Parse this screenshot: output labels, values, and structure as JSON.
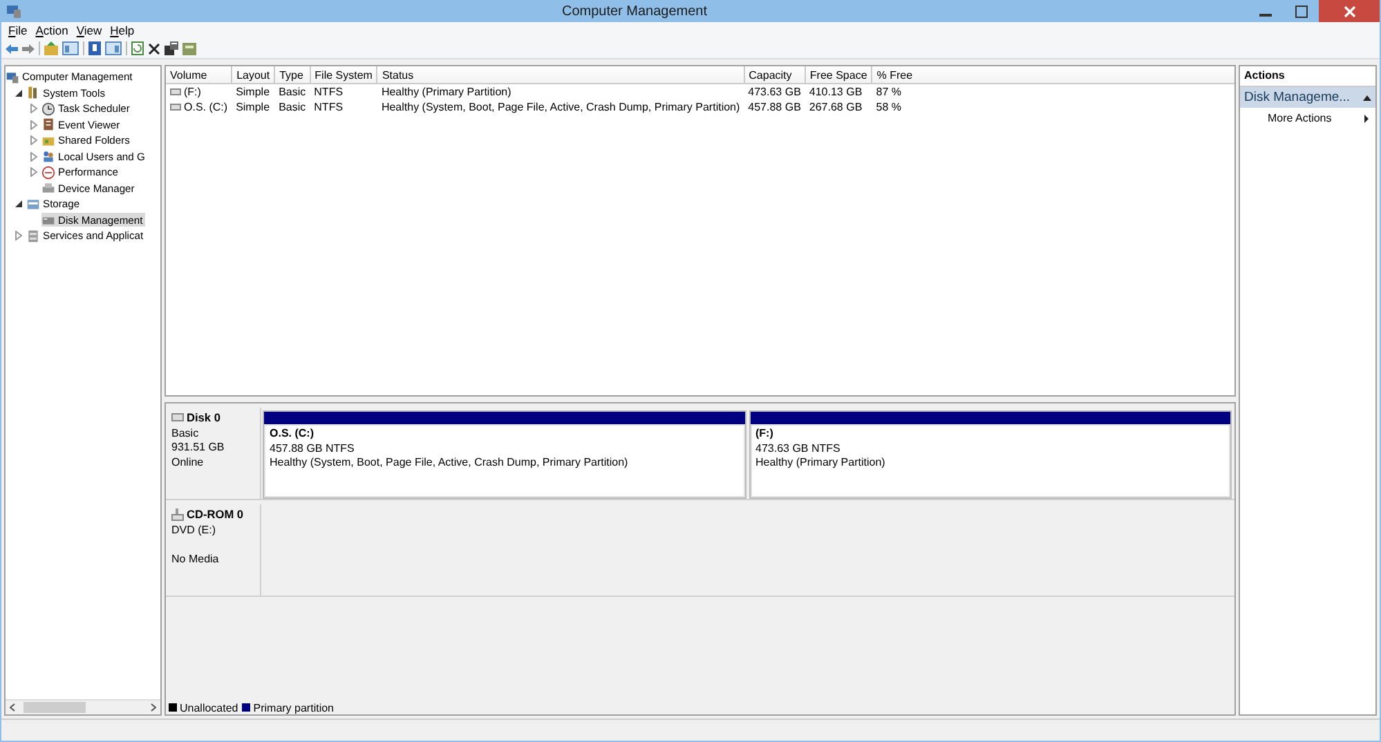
{
  "window": {
    "title": "Computer Management"
  },
  "menu": [
    "File",
    "Action",
    "View",
    "Help"
  ],
  "tree": [
    {
      "label": "Computer Management",
      "selected": false,
      "children": [
        {
          "label": "System Tools",
          "expanded": true,
          "selected": false,
          "children": [
            {
              "label": "Task Scheduler",
              "expanded": false,
              "selected": false
            },
            {
              "label": "Event Viewer",
              "expanded": false,
              "selected": false
            },
            {
              "label": "Shared Folders",
              "expanded": false,
              "selected": false
            },
            {
              "label": "Local Users and G",
              "expanded": false,
              "selected": false
            },
            {
              "label": "Performance",
              "expanded": false,
              "selected": false
            },
            {
              "label": "Device Manager",
              "selected": false
            }
          ]
        },
        {
          "label": "Storage",
          "expanded": true,
          "selected": false,
          "children": [
            {
              "label": "Disk Management",
              "selected": true
            }
          ]
        },
        {
          "label": "Services and Applicat",
          "expanded": false,
          "selected": false
        }
      ]
    }
  ],
  "volumes": {
    "columns": [
      "Volume",
      "Layout",
      "Type",
      "File System",
      "Status",
      "Capacity",
      "Free Space",
      "% Free"
    ],
    "rows": [
      {
        "cells": [
          "(F:)",
          "Simple",
          "Basic",
          "NTFS",
          "Healthy (Primary Partition)",
          "473.63 GB",
          "410.13 GB",
          "87 %"
        ]
      },
      {
        "cells": [
          "O.S. (C:)",
          "Simple",
          "Basic",
          "NTFS",
          "Healthy (System, Boot, Page File, Active, Crash Dump, Primary Partition)",
          "457.88 GB",
          "267.68 GB",
          "58 %"
        ]
      }
    ]
  },
  "disks": [
    {
      "kind": "disk",
      "name": "Disk 0",
      "type": "Basic",
      "size": "931.51 GB",
      "status": "Online",
      "partitions": [
        {
          "title": "O.S.  (C:)",
          "size": "457.88 GB NTFS",
          "status": "Healthy (System, Boot, Page File, Active, Crash Dump, Primary Partition)",
          "color": "#000080"
        },
        {
          "title": "(F:)",
          "size": "473.63 GB NTFS",
          "status": "Healthy (Primary Partition)",
          "color": "#000080"
        }
      ]
    },
    {
      "kind": "cdrom",
      "name": "CD-ROM 0",
      "type": "DVD (E:)",
      "status": "No Media"
    }
  ],
  "legend": [
    {
      "label": "Unallocated",
      "color": "#000000"
    },
    {
      "label": "Primary partition",
      "color": "#000080"
    }
  ],
  "actions": {
    "title": "Actions",
    "section": "Disk Manageme...",
    "items": [
      "More Actions"
    ]
  }
}
